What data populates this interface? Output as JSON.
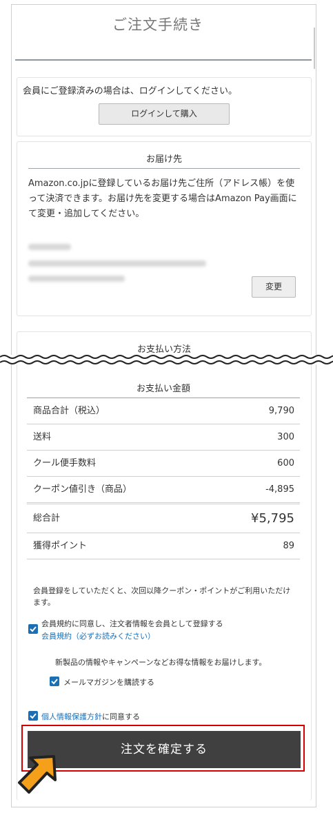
{
  "page_title": "ご注文手続き",
  "login": {
    "message": "会員にご登録済みの場合は、ログインしてください。",
    "button_label": "ログインして購入"
  },
  "shipping": {
    "heading": "お届け先",
    "description": "Amazon.co.jpに登録しているお届け先ご住所（アドレス帳）を使って決済できます。お届け先を変更する場合はAmazon Pay画面にて変更・追加してください。",
    "change_button": "変更"
  },
  "payment": {
    "heading": "お支払い方法"
  },
  "amount": {
    "heading": "お支払い金額",
    "rows": [
      {
        "label": "商品合計（税込）",
        "value": "9,790"
      },
      {
        "label": "送料",
        "value": "300"
      },
      {
        "label": "クール便手数料",
        "value": "600"
      },
      {
        "label": "クーポン値引き（商品）",
        "value": "-4,895"
      }
    ],
    "total_label": "総合計",
    "total_value": "¥5,795",
    "points_label": "獲得ポイント",
    "points_value": "89"
  },
  "membership": {
    "note": "会員登録をしていただくと、次回以降クーポン・ポイントがご利用いただけます。",
    "agree_label": "会員規約に同意し、注文者情報を会員として登録する",
    "terms_link": "会員規約（必ずお読みください）",
    "newsletter_note": "新製品の情報やキャンペーンなどお得な情報をお届けします。",
    "newsletter_label": "メールマガジンを購読する",
    "privacy_link": "個人情報保護方針",
    "privacy_suffix": "に同意する"
  },
  "confirm_button": "注文を確定する",
  "colors": {
    "checkbox": "#1b6fb5",
    "confirm_bg": "#404040",
    "highlight": "#d40000",
    "cursor": "#f5a01a"
  }
}
